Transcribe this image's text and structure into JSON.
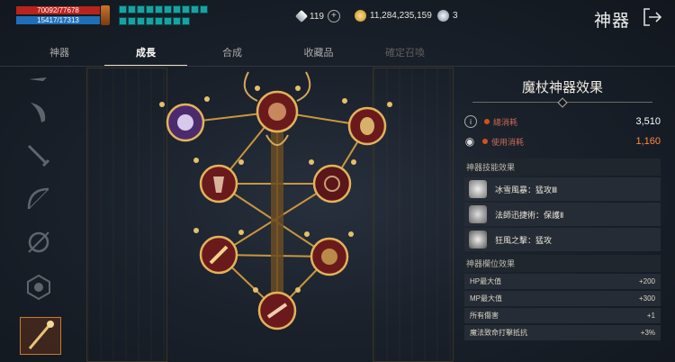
{
  "status": {
    "hp_text": "70092/77678",
    "mp_text": "15417/17313",
    "hp_color": "#b8231d",
    "mp_color": "#1f6fb8"
  },
  "currencies": [
    {
      "name": "diamond",
      "icon": "diamond-icon",
      "value": "119"
    },
    {
      "name": "gold",
      "icon": "gold-coin-icon",
      "value": "11,284,235,159"
    },
    {
      "name": "silver",
      "icon": "silver-coin-icon",
      "value": "3"
    }
  ],
  "header": {
    "title": "神器"
  },
  "tabs": [
    {
      "label": "神器",
      "state": "normal"
    },
    {
      "label": "成長",
      "state": "active"
    },
    {
      "label": "合成",
      "state": "normal"
    },
    {
      "label": "收藏品",
      "state": "normal"
    },
    {
      "label": "確定召喚",
      "state": "disabled"
    }
  ],
  "left_icons": [
    "knife-icon",
    "dagger-icon",
    "bow-icon",
    "crossbow-icon",
    "orb-icon",
    "wand-icon"
  ],
  "panel": {
    "title": "魔杖神器效果",
    "total_label": "總消耗",
    "total_value": "3,510",
    "used_label": "使用消耗",
    "used_value": "1,160",
    "used_color": "#ff8a3a",
    "skills_header": "神器技能效果",
    "skills": [
      {
        "name": "冰雪風暴：猛攻Ⅲ",
        "icon": "snowflake-icon"
      },
      {
        "name": "法師迅捷術：保護Ⅱ",
        "icon": "hand-icon"
      },
      {
        "name": "狂風之擊：猛攻",
        "icon": "wind-icon"
      }
    ],
    "slots_header": "神器欄位效果",
    "attributes": [
      {
        "name": "HP最大值",
        "value": "+200"
      },
      {
        "name": "MP最大值",
        "value": "+300"
      },
      {
        "name": "所有傷害",
        "value": "+1"
      },
      {
        "name": "魔法致命打擊抵抗",
        "value": "+3%"
      }
    ]
  }
}
